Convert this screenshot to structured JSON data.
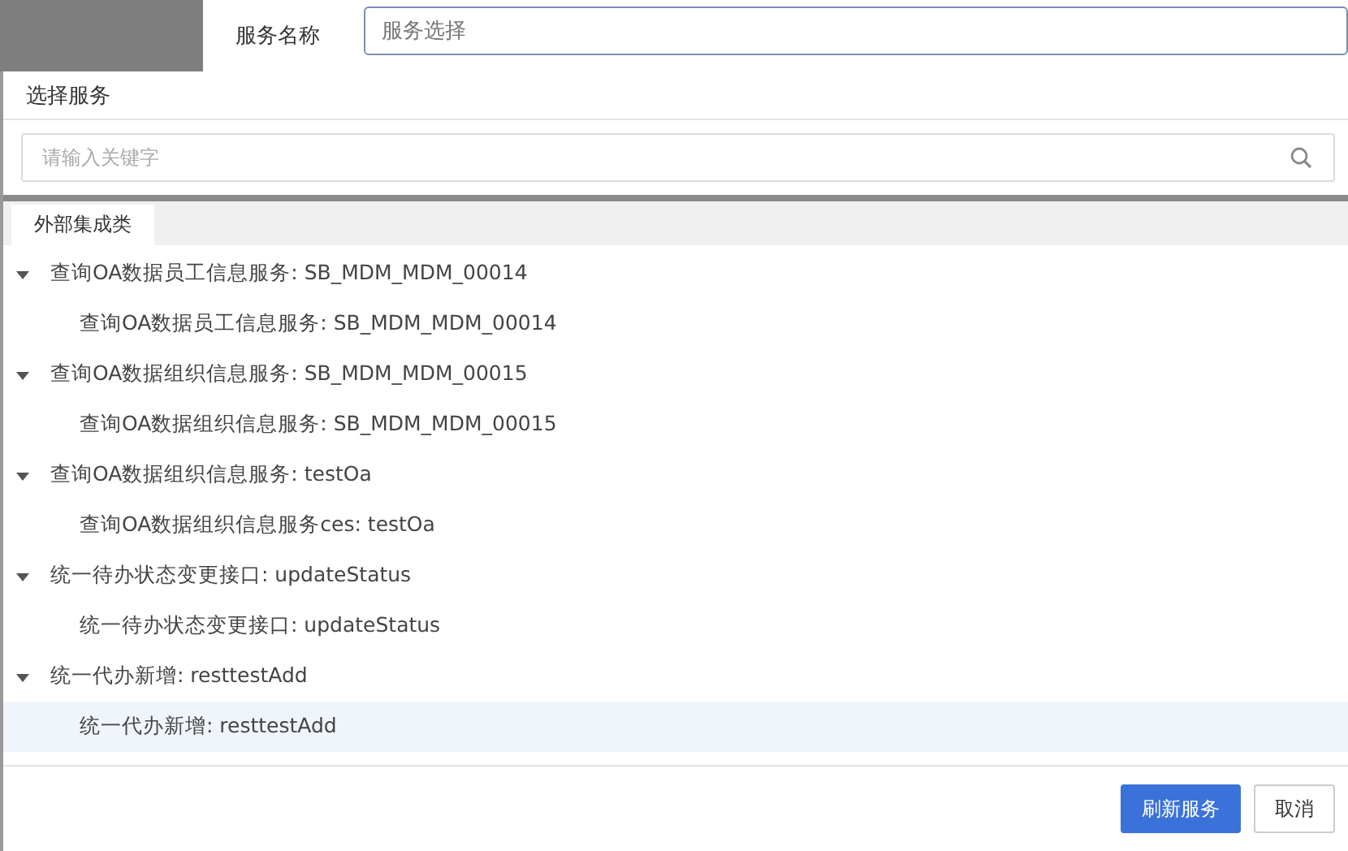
{
  "form": {
    "label": "服务名称",
    "placeholder": "服务选择"
  },
  "dialog": {
    "title": "选择服务",
    "search": {
      "placeholder": "请输入关键字"
    },
    "tabs": [
      {
        "label": "外部集成类",
        "selected": true
      }
    ],
    "tree": [
      {
        "label": "查询OA数据员工信息服务: SB_MDM_MDM_00014",
        "expanded": true,
        "selected": false,
        "children": [
          {
            "label": "查询OA数据员工信息服务: SB_MDM_MDM_00014",
            "selected": false
          }
        ]
      },
      {
        "label": "查询OA数据组织信息服务: SB_MDM_MDM_00015",
        "expanded": true,
        "selected": false,
        "children": [
          {
            "label": "查询OA数据组织信息服务: SB_MDM_MDM_00015",
            "selected": false
          }
        ]
      },
      {
        "label": "查询OA数据组织信息服务: testOa",
        "expanded": true,
        "selected": false,
        "children": [
          {
            "label": "查询OA数据组织信息服务ces: testOa",
            "selected": false
          }
        ]
      },
      {
        "label": "统一待办状态变更接口: updateStatus",
        "expanded": true,
        "selected": false,
        "children": [
          {
            "label": "统一待办状态变更接口: updateStatus",
            "selected": false
          }
        ]
      },
      {
        "label": "统一代办新增: resttestAdd",
        "expanded": true,
        "selected": false,
        "children": [
          {
            "label": "统一代办新增: resttestAdd",
            "selected": true
          }
        ]
      }
    ],
    "buttons": [
      {
        "label": "刷新服务",
        "kind": "primary"
      },
      {
        "label": "取消",
        "kind": "default"
      }
    ]
  }
}
